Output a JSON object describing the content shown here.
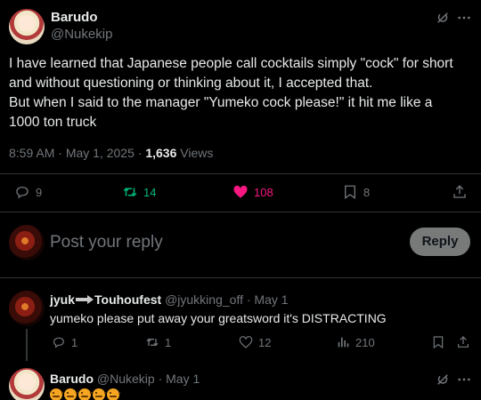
{
  "main_tweet": {
    "author_name": "Barudo",
    "author_handle": "@Nukekip",
    "text_lines": [
      "I have learned that Japanese people call cocktails simply \"cock\" for short",
      "and without questioning or thinking about it, I accepted that.",
      "But when I said to the manager \"Yumeko cock please!\" it hit me like a",
      "1000 ton truck"
    ],
    "time": "8:59 AM",
    "date": "May 1, 2025",
    "views_count": "1,636",
    "views_label": "Views",
    "replies": "9",
    "retweets": "14",
    "likes": "108",
    "bookmarks": "8",
    "colors": {
      "retweet": "#00ba7c",
      "like": "#f91880"
    }
  },
  "compose": {
    "placeholder": "Post your reply",
    "button_label": "Reply"
  },
  "replies": [
    {
      "author_name_prefix": "jyuk",
      "author_name_suffix": "Touhoufest",
      "author_handle": "@jyukking_off",
      "date": "May 1",
      "text": "yumeko please put away your greatsword it's DISTRACTING",
      "replies": "1",
      "retweets": "1",
      "likes": "12",
      "views": "210"
    },
    {
      "author_name": "Barudo",
      "author_handle": "@Nukekip",
      "date": "May 1",
      "emoji_count": 5
    }
  ],
  "icons": [
    "grok-icon",
    "more-icon",
    "reply-icon",
    "retweet-icon",
    "heart-icon",
    "bookmark-icon",
    "share-icon",
    "views-icon"
  ]
}
